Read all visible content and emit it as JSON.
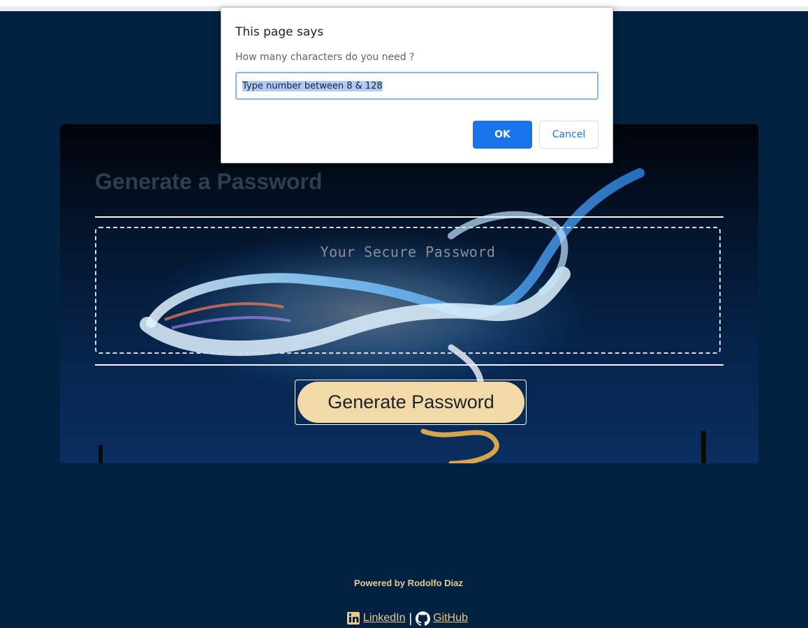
{
  "dialog": {
    "title": "This page says",
    "message": "How many characters do you need ?",
    "input_value": "Type number between 8 & 128",
    "ok_label": "OK",
    "cancel_label": "Cancel"
  },
  "card": {
    "title": "Generate a Password",
    "password_placeholder": "Your Secure Password",
    "generate_label": "Generate Password"
  },
  "footer": {
    "credit": "Powered by Rodolfo Diaz",
    "linkedin_label": "LinkedIn",
    "separator": "|",
    "github_label": "GitHub",
    "linkedin_icon": "linkedin-icon",
    "github_icon": "github-icon"
  },
  "colors": {
    "page_background": "#032140",
    "accent_button": "#f1d9a8",
    "dialog_ok": "#1a73e8",
    "footer_text": "#e8c98e"
  }
}
